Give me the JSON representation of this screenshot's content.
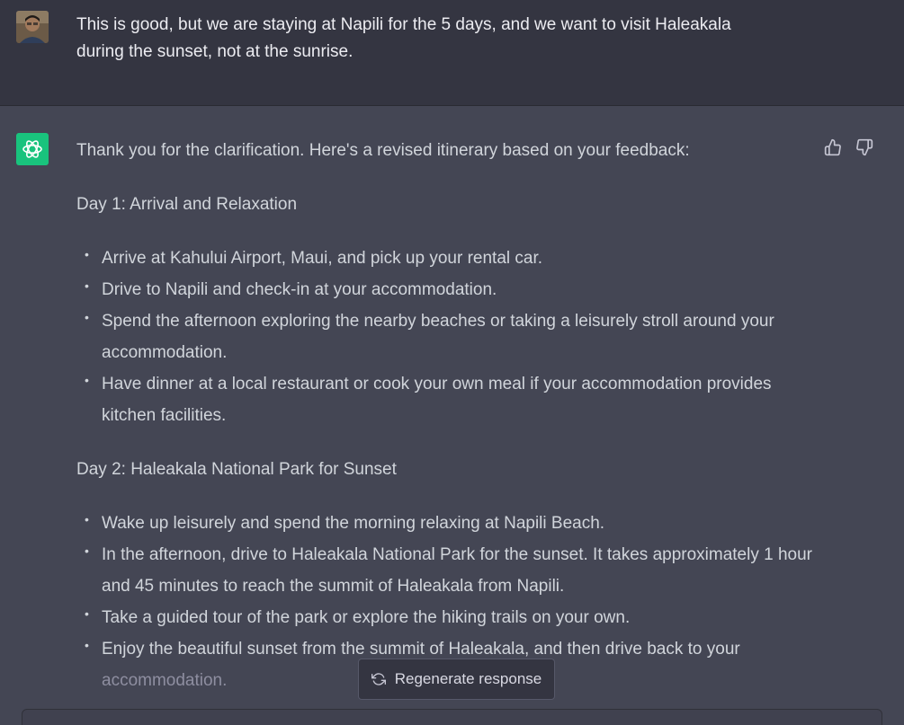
{
  "user_message": {
    "line1": "This is good, but we are staying at Napili for the 5 days, and we want to visit Haleakala",
    "line2": "during the sunset, not at the sunrise."
  },
  "assistant_message": {
    "intro": "Thank you for the clarification. Here's a revised itinerary based on your feedback:",
    "day1": {
      "heading": "Day 1: Arrival and Relaxation",
      "items": [
        "Arrive at Kahului Airport, Maui, and pick up your rental car.",
        "Drive to Napili and check-in at your accommodation.",
        "Spend the afternoon exploring the nearby beaches or taking a leisurely stroll around your accommodation.",
        "Have dinner at a local restaurant or cook your own meal if your accommodation provides kitchen facilities."
      ]
    },
    "day2": {
      "heading": "Day 2: Haleakala National Park for Sunset",
      "items": [
        "Wake up leisurely and spend the morning relaxing at Napili Beach.",
        "In the afternoon, drive to Haleakala National Park for the sunset. It takes approximately 1 hour and 45 minutes to reach the summit of Haleakala from Napili.",
        "Take a guided tour of the park or explore the hiking trails on your own.",
        "Enjoy the beautiful sunset from the summit of Haleakala, and then drive back to your",
        "accommodation."
      ]
    }
  },
  "regenerate": {
    "label": "Regenerate response",
    "icon": "refresh-icon"
  },
  "icons": {
    "like": "thumbs-up-icon",
    "dislike": "thumbs-down-icon",
    "assistant": "openai-logo-icon",
    "user": "user-avatar"
  },
  "colors": {
    "accent": "#19c37d",
    "user_bg": "#343541",
    "assistant_bg": "#444654"
  }
}
